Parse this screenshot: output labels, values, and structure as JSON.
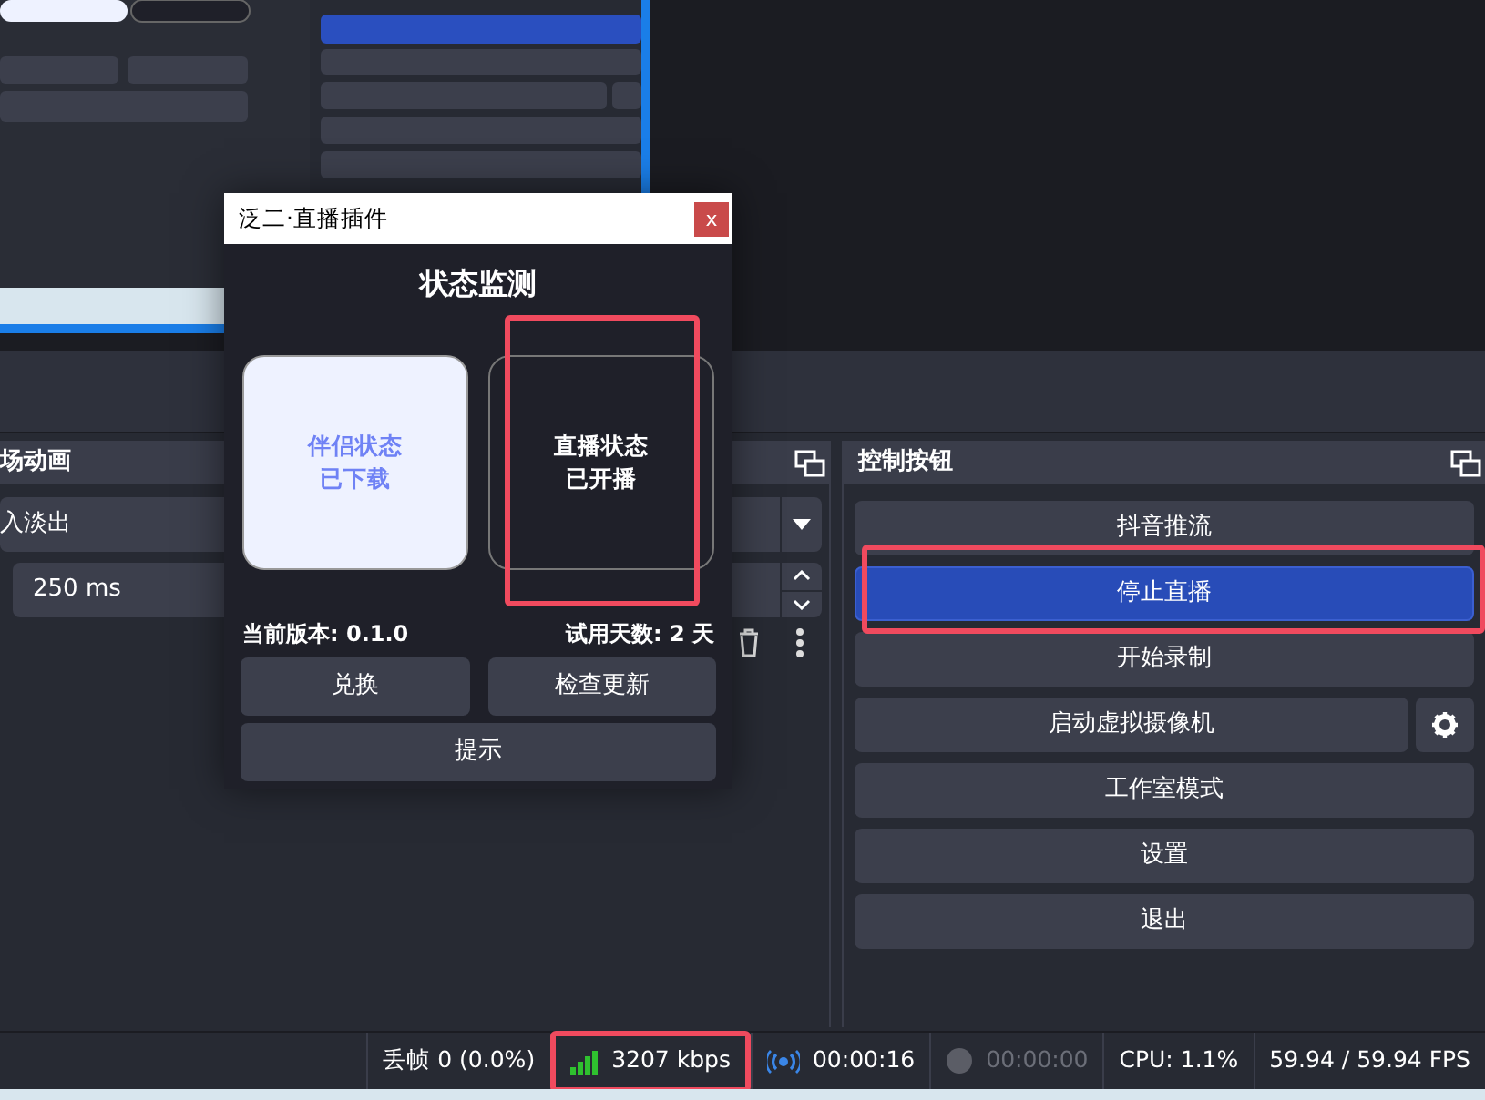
{
  "transition_dock": {
    "title": "场动画",
    "transition": "入淡出",
    "duration": "250 ms"
  },
  "controls_dock": {
    "title": "控制按钮",
    "buttons": [
      {
        "label": "抖音推流",
        "active": false,
        "kind": "plain"
      },
      {
        "label": "停止直播",
        "active": true,
        "kind": "plain"
      },
      {
        "label": "开始录制",
        "active": false,
        "kind": "plain"
      },
      {
        "label": "启动虚拟摄像机",
        "active": false,
        "kind": "with_settings"
      },
      {
        "label": "工作室模式",
        "active": false,
        "kind": "plain"
      },
      {
        "label": "设置",
        "active": false,
        "kind": "plain"
      },
      {
        "label": "退出",
        "active": false,
        "kind": "plain"
      }
    ]
  },
  "status_bar": [
    {
      "kind": "text",
      "text": "丢帧 0 (0.0%)"
    },
    {
      "kind": "bitrate",
      "text": "3207 kbps"
    },
    {
      "kind": "timer",
      "text": "00:00:16",
      "active": true
    },
    {
      "kind": "timer",
      "text": "00:00:00",
      "active": false
    },
    {
      "kind": "text",
      "text": "CPU: 1.1%"
    },
    {
      "kind": "text",
      "text": "59.94 / 59.94 FPS"
    }
  ],
  "dialog": {
    "title": "泛二·直播插件",
    "close": "x",
    "heading": "状态监测",
    "cards": [
      {
        "lines": [
          "伴侣状态",
          "已下载"
        ],
        "highlighted": true
      },
      {
        "lines": [
          "直播状态",
          "已开播"
        ],
        "highlighted": false
      }
    ],
    "version": "当前版本: 0.1.0",
    "trial": "试用天数: 2 天",
    "buttons": [
      "兑换",
      "检查更新",
      "提示"
    ]
  }
}
